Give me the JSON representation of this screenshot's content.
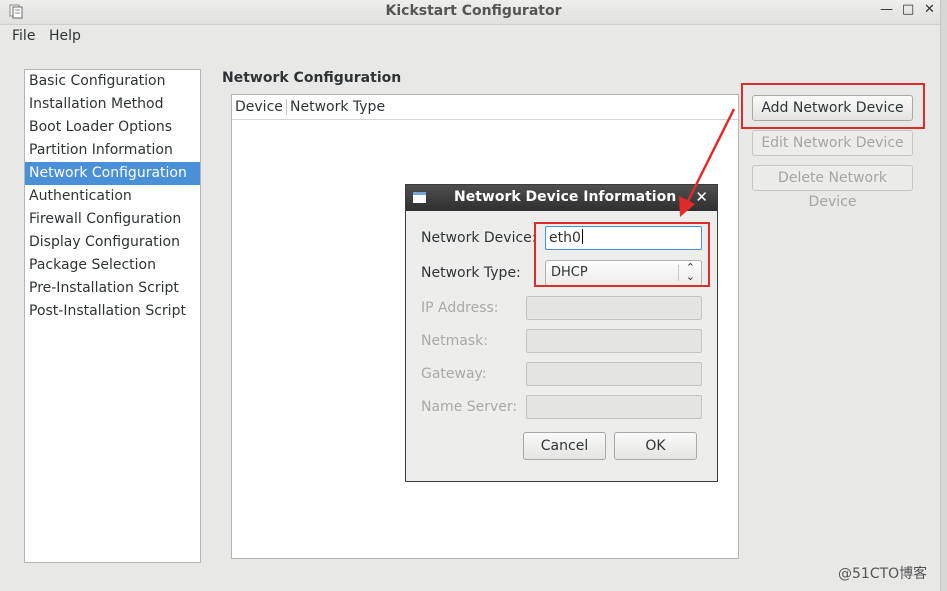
{
  "window": {
    "title": "Kickstart Configurator"
  },
  "menu": {
    "file": "File",
    "help": "Help"
  },
  "sidebar": {
    "items": [
      {
        "label": "Basic Configuration"
      },
      {
        "label": "Installation Method"
      },
      {
        "label": "Boot Loader Options"
      },
      {
        "label": "Partition Information"
      },
      {
        "label": "Network Configuration",
        "selected": true
      },
      {
        "label": "Authentication"
      },
      {
        "label": "Firewall Configuration"
      },
      {
        "label": "Display Configuration"
      },
      {
        "label": "Package Selection"
      },
      {
        "label": "Pre-Installation Script"
      },
      {
        "label": "Post-Installation Script"
      }
    ]
  },
  "main": {
    "title": "Network Configuration",
    "table": {
      "columns": [
        "Device",
        "Network Type"
      ]
    },
    "buttons": {
      "add": "Add Network Device",
      "edit": "Edit Network Device",
      "delete": "Delete Network Device"
    }
  },
  "dialog": {
    "title": "Network Device Information",
    "fields": {
      "device_label": "Network Device:",
      "device_value": "eth0",
      "type_label": "Network Type:",
      "type_value": "DHCP",
      "ip_label": "IP Address:",
      "netmask_label": "Netmask:",
      "gateway_label": "Gateway:",
      "nameserver_label": "Name Server:"
    },
    "buttons": {
      "cancel": "Cancel",
      "ok": "OK"
    }
  },
  "watermark": "@51CTO博客",
  "colors": {
    "selection": "#4a90d9",
    "annotation": "#e02b2b"
  }
}
